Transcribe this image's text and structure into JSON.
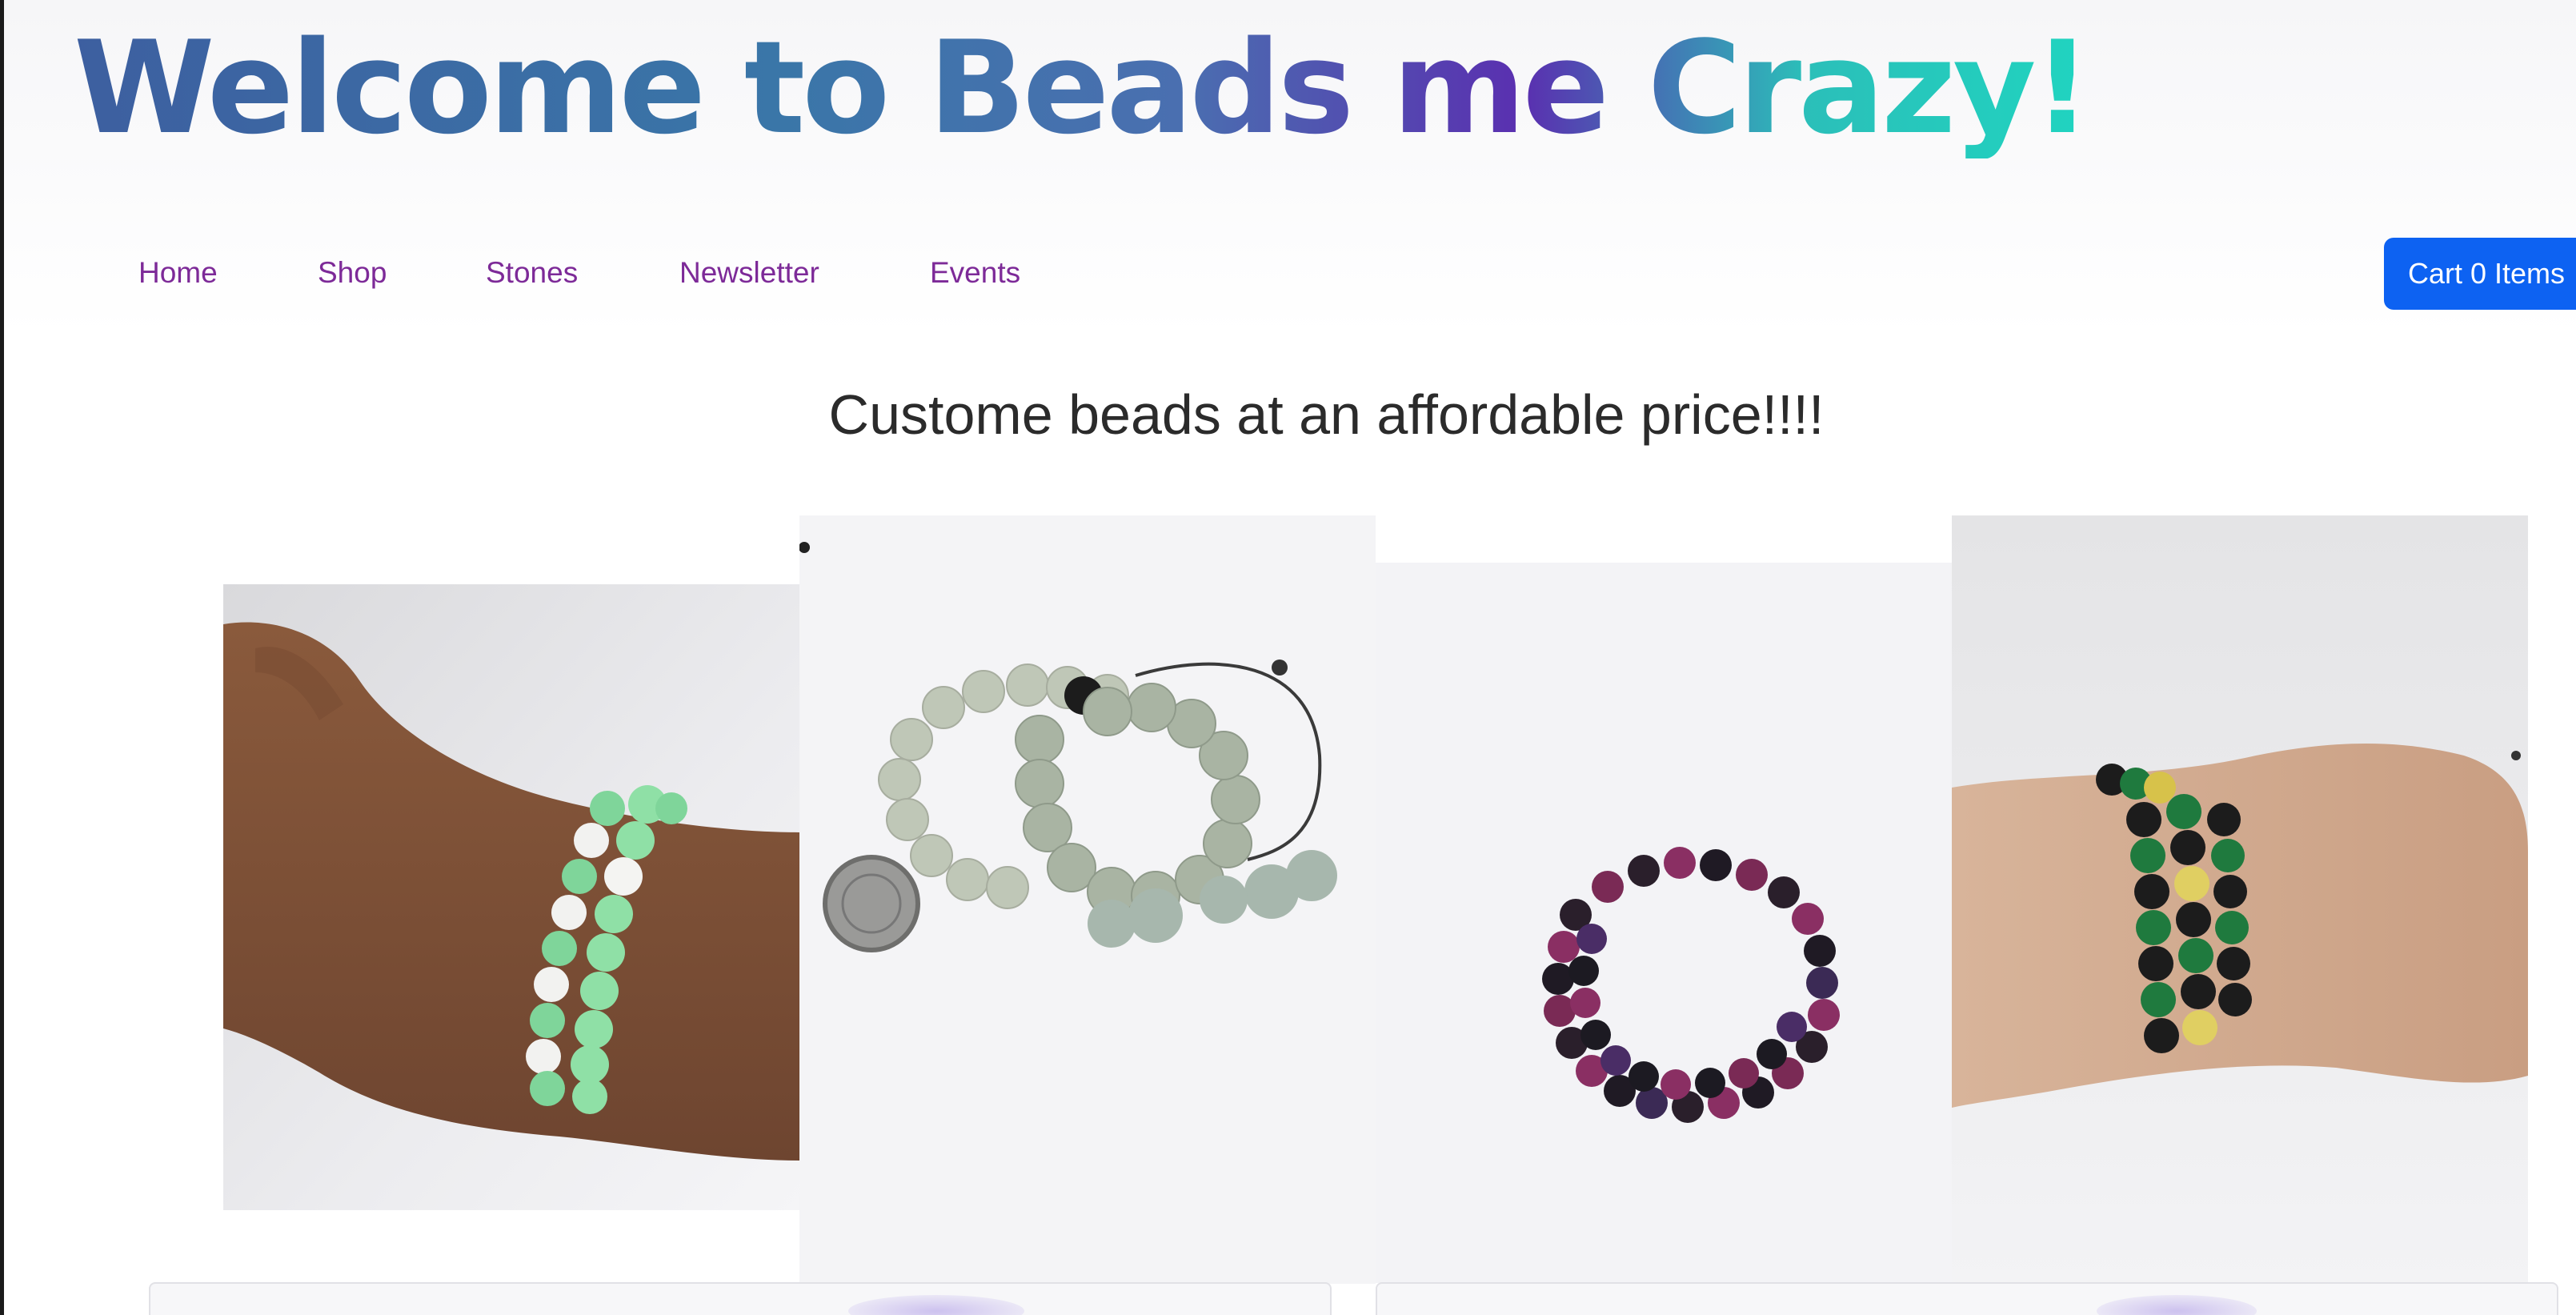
{
  "header": {
    "title": "Welcome to Beads me Crazy!"
  },
  "nav": {
    "items": [
      {
        "label": "Home"
      },
      {
        "label": "Shop"
      },
      {
        "label": "Stones"
      },
      {
        "label": "Newsletter"
      },
      {
        "label": "Events"
      }
    ],
    "cart_label": "Cart 0 Items"
  },
  "main": {
    "tagline": "Custome beads at an affordable price!!!!"
  },
  "products": [
    {
      "image": "green-white-bracelet-on-wrist"
    },
    {
      "image": "grey-jade-adjustable-bracelets"
    },
    {
      "image": "purple-black-bracelets"
    },
    {
      "image": "green-black-tiger-eye-bracelet-on-wrist"
    }
  ],
  "colors": {
    "title_gradient_start": "#3d5fa0",
    "title_gradient_end": "#20d4c0",
    "nav_link": "#7d2a98",
    "cart_button": "#0d62f2"
  }
}
